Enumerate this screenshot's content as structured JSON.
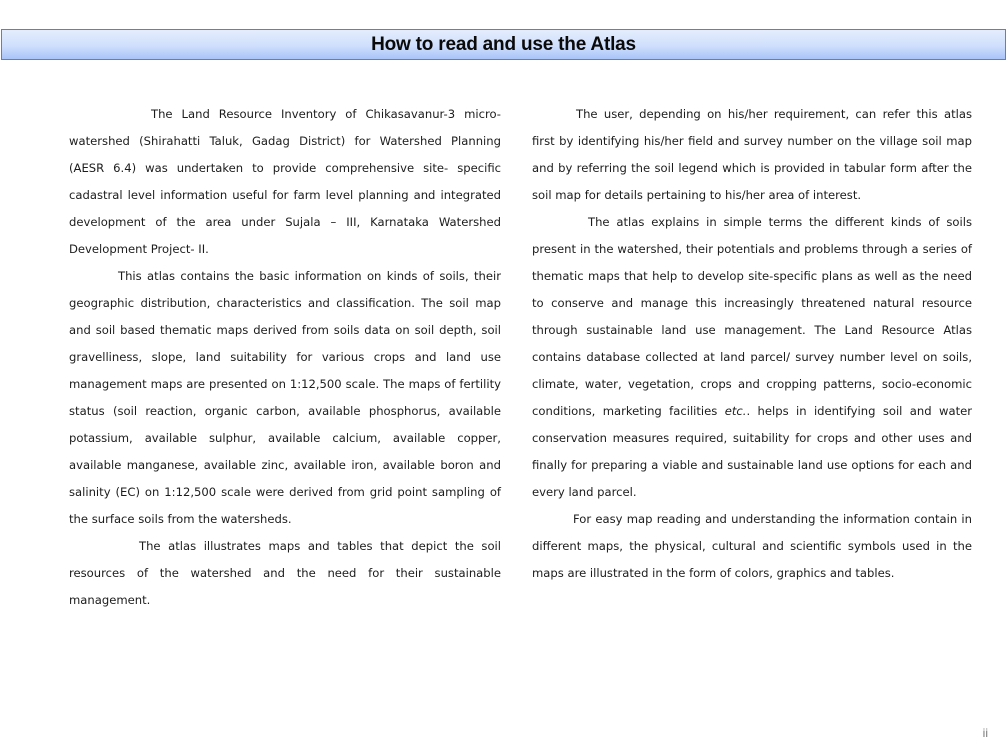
{
  "header": {
    "title": "How to read and use the Atlas",
    "background_top": "#e4edfd",
    "background_bottom": "#a8c4f7",
    "border_color": "#6f7f96"
  },
  "left_column": {
    "paragraphs": [
      "The Land Resource Inventory of Chikasavanur-3 micro-watershed (Shirahatti Taluk, Gadag District) for Watershed Planning (AESR 6.4) was undertaken to provide comprehensive site- specific cadastral level information useful for farm level planning and integrated development of the area under Sujala – III, Karnataka Watershed Development Project- II.",
      "This atlas contains the basic information on kinds of soils, their geographic distribution, characteristics and classification. The soil map and soil based thematic maps derived from soils data on soil depth, soil gravelliness, slope, land suitability for various crops and land use management maps are presented on 1:12,500 scale. The maps of fertility status (soil reaction, organic carbon, available phosphorus, available potassium, available sulphur, available calcium, available copper, available manganese, available zinc, available iron, available boron and salinity (EC) on 1:12,500 scale were derived from grid point sampling of the surface soils from the watersheds.",
      "The atlas illustrates maps and tables that depict the soil resources of the watershed and the need for their sustainable management."
    ]
  },
  "right_column": {
    "paragraphs": [
      "The user, depending on his/her requirement, can refer this atlas first by identifying his/her field and survey number on the village soil map and by referring the soil legend which is provided in tabular form after the soil map for details pertaining to his/her area of interest.",
      "The atlas explains in simple terms the different kinds of soils present in the watershed, their potentials and problems through a series of thematic maps that help to develop site-specific plans as well as the need to conserve and manage this increasingly threatened natural resource through sustainable land use management. The Land Resource Atlas contains database collected at land parcel/ survey number level on soils, climate, water, vegetation, crops and cropping patterns, socio-economic conditions, marketing facilities",
      "etc.",
      ". helps in identifying soil and water conservation measures required, suitability for crops and other uses and finally for preparing a viable and sustainable land use options for each and every land parcel.",
      "For easy map reading and understanding the information contain in different maps, the physical, cultural and scientific symbols used in the maps are illustrated in the form of colors, graphics and tables."
    ]
  },
  "footer": {
    "page_number": "ii"
  }
}
